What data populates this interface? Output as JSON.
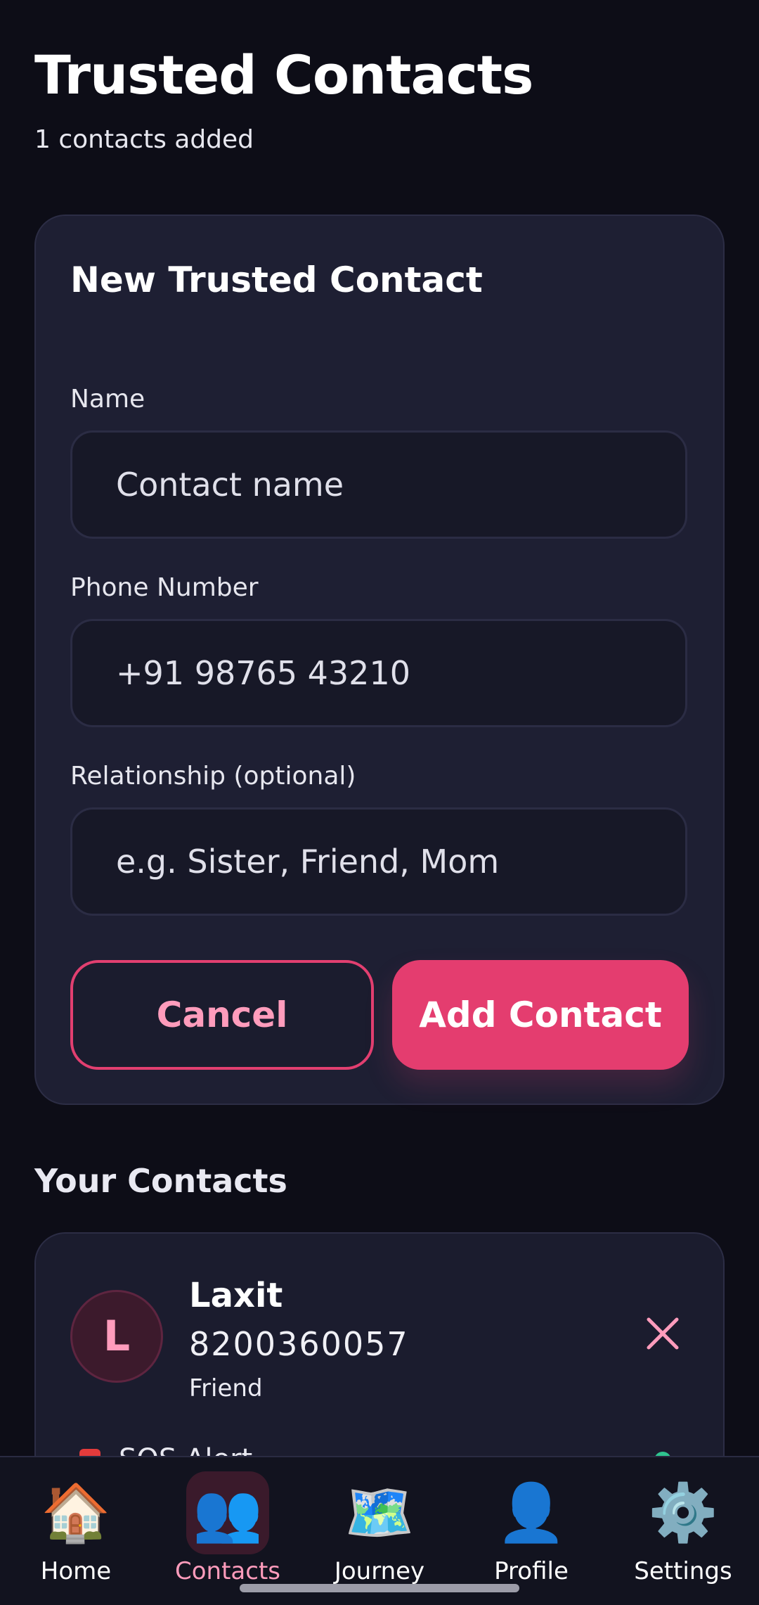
{
  "header": {
    "title": "Trusted Contacts",
    "subtitle": "1 contacts added"
  },
  "form": {
    "title": "New Trusted Contact",
    "name_label": "Name",
    "name_placeholder": "Contact name",
    "phone_label": "Phone Number",
    "phone_placeholder": "+91 98765 43210",
    "relationship_label": "Relationship (optional)",
    "relationship_placeholder": "e.g. Sister, Friend, Mom",
    "cancel_label": "Cancel",
    "add_label": "Add Contact"
  },
  "contacts_section": {
    "title": "Your Contacts",
    "items": [
      {
        "initial": "L",
        "name": "Laxit",
        "phone": "8200360057",
        "relationship": "Friend",
        "remove_icon": "close-icon"
      }
    ],
    "next_item_peek": {
      "text": "SOS Alert",
      "icon": "alert-icon"
    }
  },
  "nav": {
    "items": [
      {
        "label": "Home",
        "icon": "🏠",
        "icon_name": "home-icon",
        "active": false
      },
      {
        "label": "Contacts",
        "icon": "👥",
        "icon_name": "contacts-icon",
        "active": true
      },
      {
        "label": "Journey",
        "icon": "🗺️",
        "icon_name": "map-icon",
        "active": false
      },
      {
        "label": "Profile",
        "icon": "👤",
        "icon_name": "profile-icon",
        "active": false
      },
      {
        "label": "Settings",
        "icon": "⚙️",
        "icon_name": "gear-icon",
        "active": false
      }
    ]
  },
  "colors": {
    "background": "#0d0d17",
    "card": "#1e1f33",
    "accent": "#e43d6f",
    "accent_light": "#ff9cbc"
  }
}
